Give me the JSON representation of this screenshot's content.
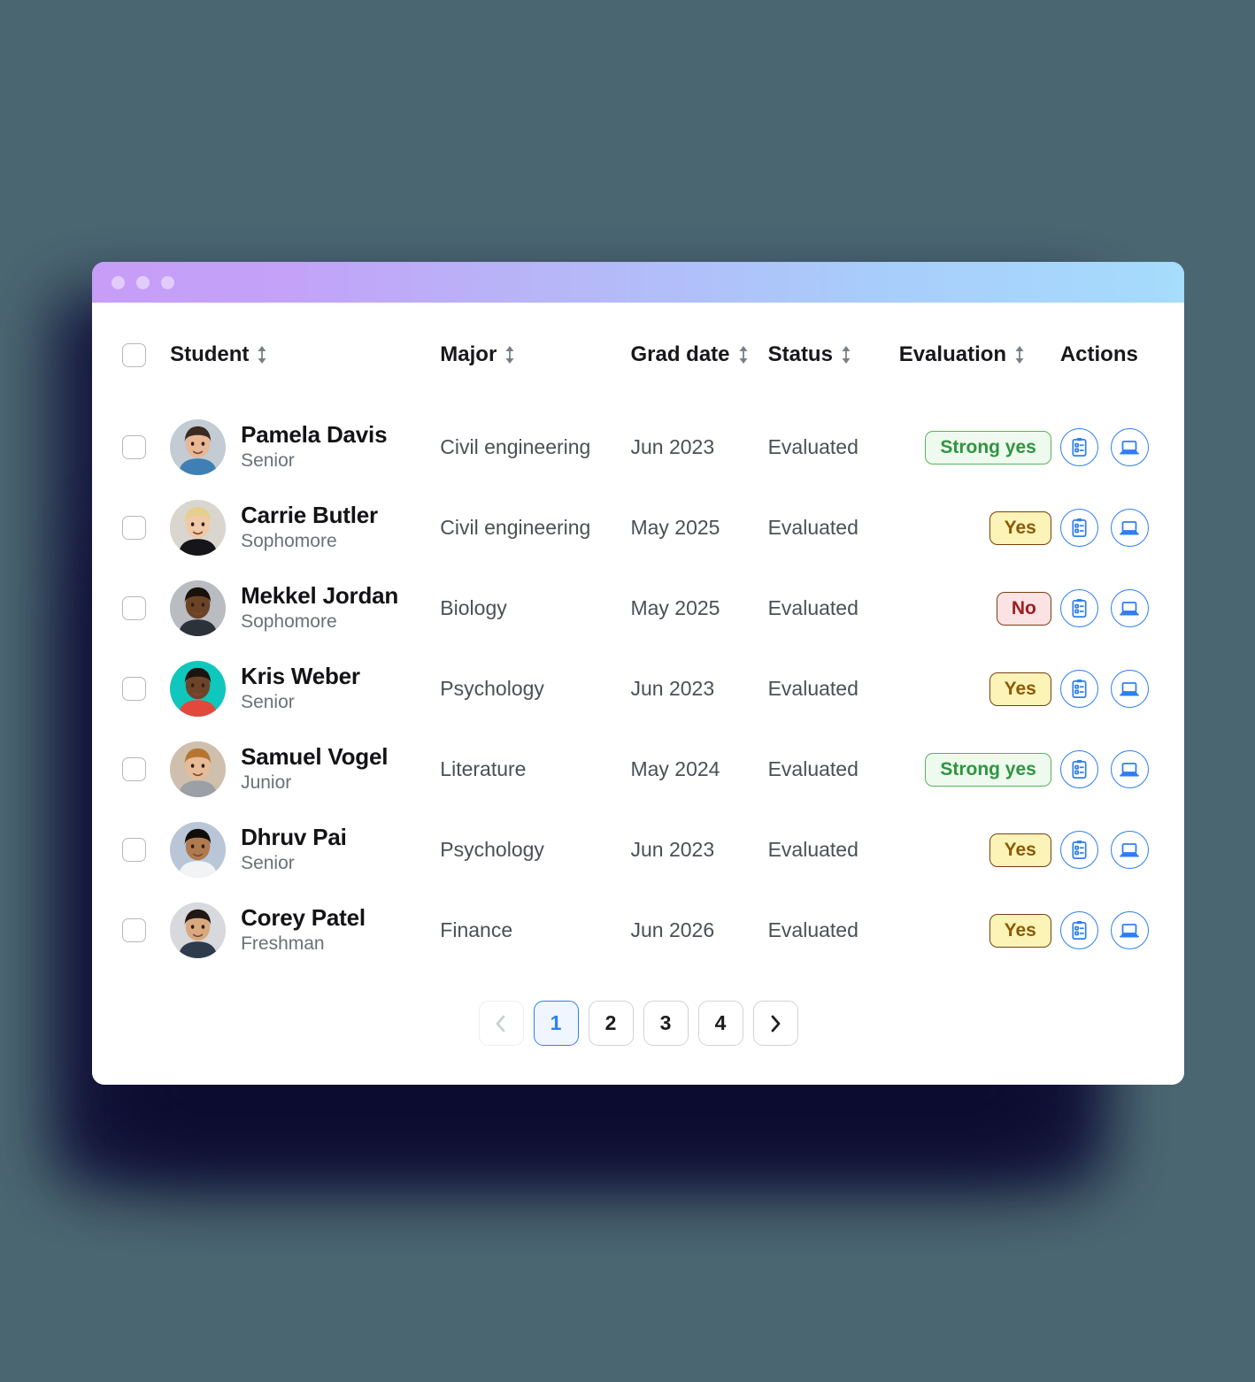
{
  "window": {
    "traffic_lights": [
      "close",
      "minimize",
      "maximize"
    ]
  },
  "table": {
    "columns": [
      {
        "key": "select",
        "label": "",
        "sortable": false,
        "icon": "select-all-checkbox"
      },
      {
        "key": "student",
        "label": "Student",
        "sortable": true,
        "icon": "sort-icon"
      },
      {
        "key": "major",
        "label": "Major",
        "sortable": true,
        "icon": "sort-icon"
      },
      {
        "key": "grad_date",
        "label": "Grad date",
        "sortable": true,
        "icon": "sort-icon"
      },
      {
        "key": "status",
        "label": "Status",
        "sortable": true,
        "icon": "sort-icon"
      },
      {
        "key": "evaluation",
        "label": "Evaluation",
        "sortable": true,
        "icon": "sort-icon"
      },
      {
        "key": "actions",
        "label": "Actions",
        "sortable": false,
        "icon": null
      }
    ],
    "rows": [
      {
        "name": "Pamela Davis",
        "year": "Senior",
        "major": "Civil engineering",
        "grad_date": "Jun 2023",
        "status": "Evaluated",
        "evaluation": "Strong yes",
        "evaluation_type": "strong-yes",
        "selected": false,
        "avatar": {
          "skin": "#e8b796",
          "hair": "#3b2a22",
          "bg": "#c3ccd4",
          "clothes": "#3f7fb5"
        },
        "actions": [
          "evaluation-form-icon",
          "interview-laptop-icon"
        ]
      },
      {
        "name": "Carrie Butler",
        "year": "Sophomore",
        "major": "Civil engineering",
        "grad_date": "May 2025",
        "status": "Evaluated",
        "evaluation": "Yes",
        "evaluation_type": "yes",
        "selected": false,
        "avatar": {
          "skin": "#f0c9a8",
          "hair": "#e4cf8e",
          "bg": "#d9d6cf",
          "clothes": "#15151a"
        },
        "actions": [
          "evaluation-form-icon",
          "interview-laptop-icon"
        ]
      },
      {
        "name": "Mekkel Jordan",
        "year": "Sophomore",
        "major": "Biology",
        "grad_date": "May 2025",
        "status": "Evaluated",
        "evaluation": "No",
        "evaluation_type": "no",
        "selected": false,
        "avatar": {
          "skin": "#6b4326",
          "hair": "#19110c",
          "bg": "#b9bcc0",
          "clothes": "#2c3239"
        },
        "actions": [
          "evaluation-form-icon",
          "interview-laptop-icon"
        ]
      },
      {
        "name": "Kris Weber",
        "year": "Senior",
        "major": "Psychology",
        "grad_date": "Jun 2023",
        "status": "Evaluated",
        "evaluation": "Yes",
        "evaluation_type": "yes",
        "selected": false,
        "avatar": {
          "skin": "#6e4429",
          "hair": "#1b1410",
          "bg": "#10c7bd",
          "clothes": "#e2483c"
        },
        "actions": [
          "evaluation-form-icon",
          "interview-laptop-icon"
        ]
      },
      {
        "name": "Samuel Vogel",
        "year": "Junior",
        "major": "Literature",
        "grad_date": "May 2024",
        "status": "Evaluated",
        "evaluation": "Strong yes",
        "evaluation_type": "strong-yes",
        "selected": false,
        "avatar": {
          "skin": "#e7bb98",
          "hair": "#b5752f",
          "bg": "#cfc0ae",
          "clothes": "#9aa0a5"
        },
        "actions": [
          "evaluation-form-icon",
          "interview-laptop-icon"
        ]
      },
      {
        "name": "Dhruv Pai",
        "year": "Senior",
        "major": "Psychology",
        "grad_date": "Jun 2023",
        "status": "Evaluated",
        "evaluation": "Yes",
        "evaluation_type": "yes",
        "selected": false,
        "avatar": {
          "skin": "#b07a4f",
          "hair": "#110d0a",
          "bg": "#b9c6d8",
          "clothes": "#f2f3f5"
        },
        "actions": [
          "evaluation-form-icon",
          "interview-laptop-icon"
        ]
      },
      {
        "name": "Corey Patel",
        "year": "Freshman",
        "major": "Finance",
        "grad_date": "Jun 2026",
        "status": "Evaluated",
        "evaluation": "Yes",
        "evaluation_type": "yes",
        "selected": false,
        "avatar": {
          "skin": "#d9a87e",
          "hair": "#211713",
          "bg": "#d7d9dc",
          "clothes": "#2d3b4d"
        },
        "actions": [
          "evaluation-form-icon",
          "interview-laptop-icon"
        ]
      }
    ]
  },
  "pagination": {
    "prev_label": "‹",
    "next_label": "›",
    "prev_disabled": true,
    "pages": [
      "1",
      "2",
      "3",
      "4"
    ],
    "current_page": "1"
  },
  "colors": {
    "accent_blue": "#2f7ff0",
    "strong_yes_text": "#2f9440",
    "yes_text": "#8a5a08",
    "no_text": "#9d1c22",
    "page_background": "#4a6670"
  }
}
